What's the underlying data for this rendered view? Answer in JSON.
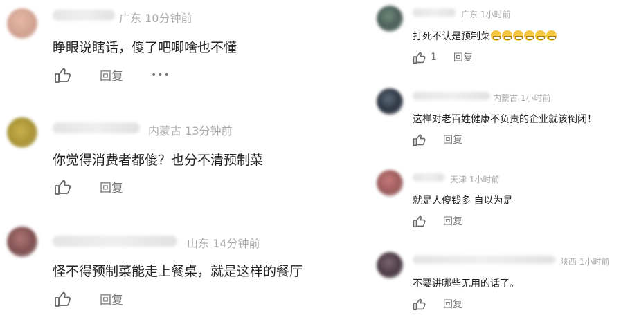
{
  "left_comments": [
    {
      "location": "广东",
      "time": "10分钟前",
      "text": "睁眼说瞎话，傻了吧唧啥也不懂",
      "reply": "回复",
      "more": "•••"
    },
    {
      "location": "内蒙古",
      "time": "13分钟前",
      "text": "你觉得消费者都傻？也分不清预制菜",
      "reply": "回复"
    },
    {
      "location": "山东",
      "time": "14分钟前",
      "text": "怪不得预制菜能走上餐桌，就是这样的餐厅",
      "reply": "回复"
    }
  ],
  "right_comments": [
    {
      "location": "广东",
      "time": "1小时前",
      "text": "打死不认是预制菜",
      "likes": "1",
      "reply": "回复"
    },
    {
      "location": "内蒙古",
      "time": "1小时前",
      "text": "这样对老百姓健康不负责的企业就该倒闭！",
      "reply": "回复"
    },
    {
      "location": "天津",
      "time": "1小时前",
      "text": "就是人傻钱多 自以为是",
      "reply": "回复"
    },
    {
      "location": "陕西",
      "time": "1小时前",
      "text": "不要讲哪些无用的话了。",
      "reply": "回复"
    }
  ],
  "icons": {
    "like": "thumbs-up-icon",
    "more": "more-icon",
    "emoji": "grinning-face-emoji"
  },
  "colors": {
    "meta": "#a8a8a8",
    "text": "#222222",
    "action": "#777777"
  }
}
